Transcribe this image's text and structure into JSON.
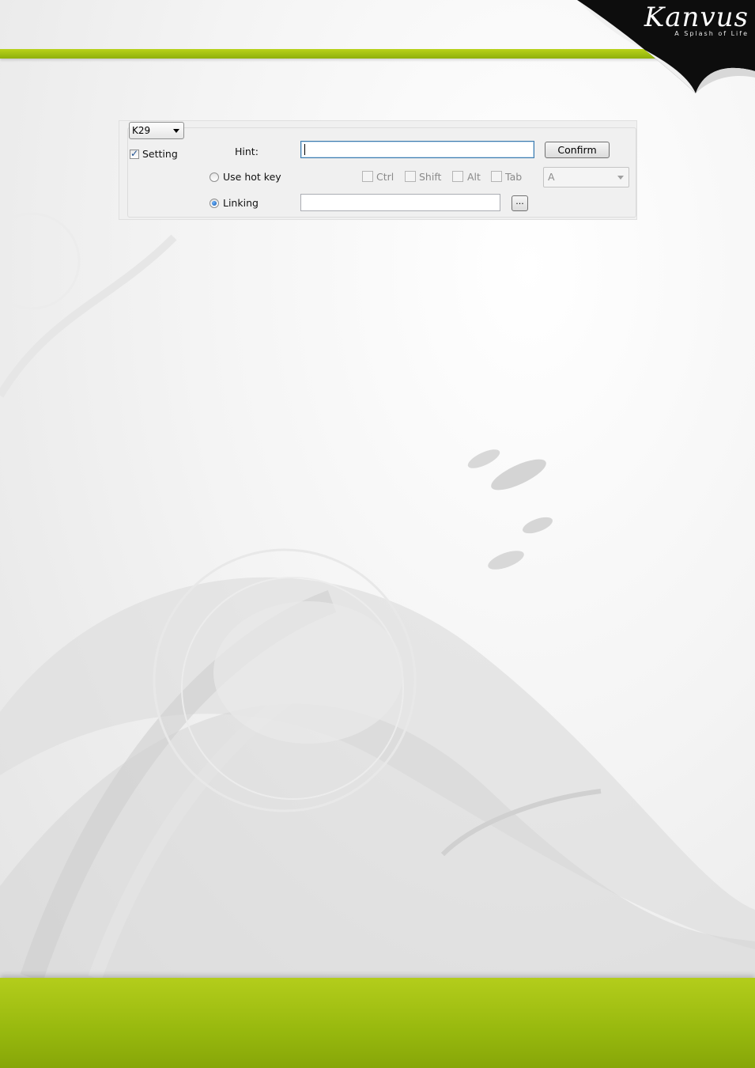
{
  "logo": {
    "text": "Kanvus",
    "tagline": "A Splash of Life"
  },
  "dialog": {
    "key_select": {
      "value": "K29"
    },
    "setting_checkbox": {
      "label": "Setting",
      "checked": true
    },
    "hint": {
      "label": "Hint:",
      "value": ""
    },
    "confirm_button": {
      "label": "Confirm"
    },
    "use_hot_key_radio": {
      "label": "Use hot key",
      "selected": false
    },
    "modifiers": [
      {
        "label": "Ctrl",
        "checked": false
      },
      {
        "label": "Shift",
        "checked": false
      },
      {
        "label": "Alt",
        "checked": false
      },
      {
        "label": "Tab",
        "checked": false
      }
    ],
    "hot_key_select": {
      "value": "A"
    },
    "linking_radio": {
      "label": "Linking",
      "selected": true
    },
    "linking_path": {
      "value": ""
    },
    "browse_button": {
      "label": "..."
    }
  },
  "colors": {
    "accent_green": "#9cbc10",
    "radio_blue": "#1757a8"
  }
}
